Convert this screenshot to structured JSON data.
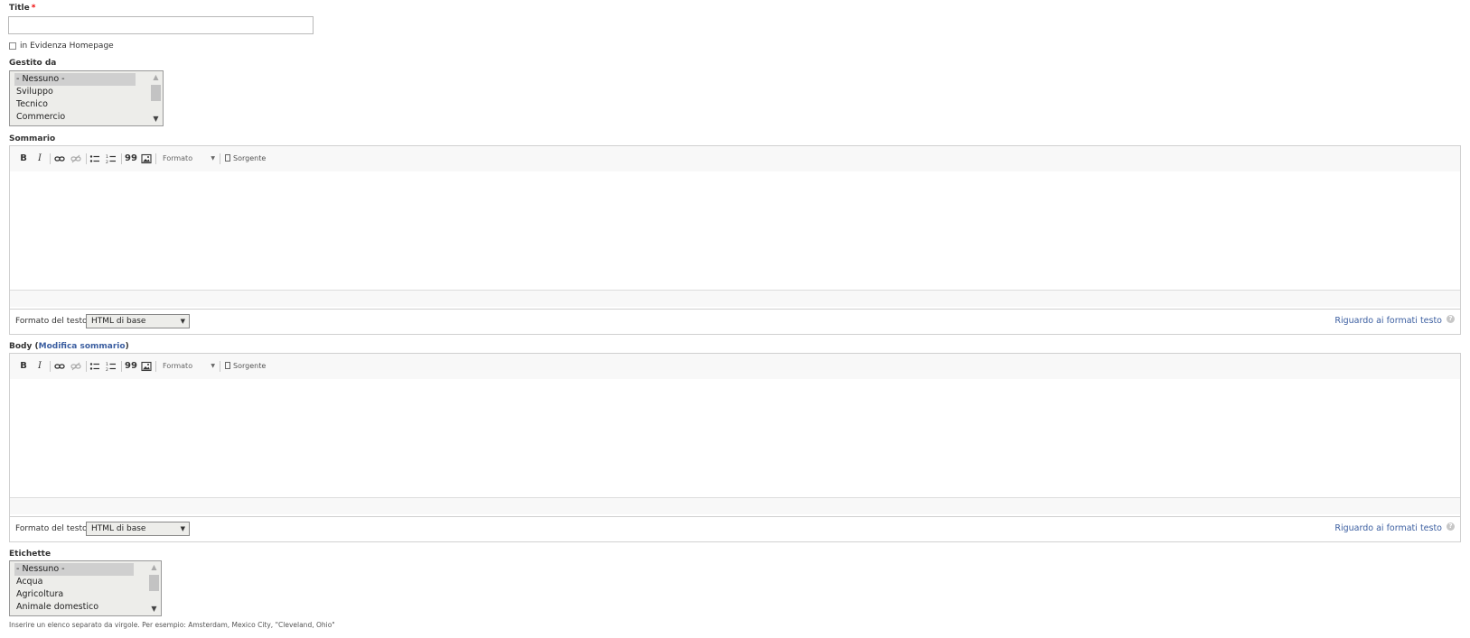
{
  "title_field": {
    "label": "Title",
    "required_mark": "*",
    "value": ""
  },
  "featured_checkbox": {
    "label": "in Evidenza Homepage",
    "checked": false
  },
  "managed_by": {
    "label": "Gestito da",
    "options": [
      "- Nessuno -",
      "Sviluppo",
      "Tecnico",
      "Commercio"
    ],
    "selected": "- Nessuno -"
  },
  "toolbar": {
    "bold": "B",
    "italic": "I",
    "link": "link-icon",
    "unlink": "unlink-icon",
    "bulleted_list": "bulleted-list-icon",
    "numbered_list": "numbered-list-icon",
    "blockquote": "99",
    "image": "image-icon",
    "format": "Formato",
    "source": "Sorgente"
  },
  "summary": {
    "label": "Sommario",
    "text_format_label": "Formato del testo",
    "text_format_value": "HTML di base",
    "format_help_link": "Riguardo ai formati testo"
  },
  "body": {
    "label": "Body",
    "paren_open": "(",
    "edit_summary_link": "Modifica sommario",
    "paren_close": ")",
    "text_format_label": "Formato del testo",
    "text_format_value": "HTML di base",
    "format_help_link": "Riguardo ai formati testo"
  },
  "tags": {
    "label": "Etichette",
    "options": [
      "- Nessuno -",
      "Acqua",
      "Agricoltura",
      "Animale domestico"
    ],
    "selected": "- Nessuno -",
    "help_text": "Inserire un elenco separato da virgole. Per esempio: Amsterdam, Mexico City, \"Cleveland, Ohio\""
  },
  "colors": {
    "link": "#3b5ea0",
    "required": "#e00000",
    "selected_option": "#cfcfcf"
  }
}
